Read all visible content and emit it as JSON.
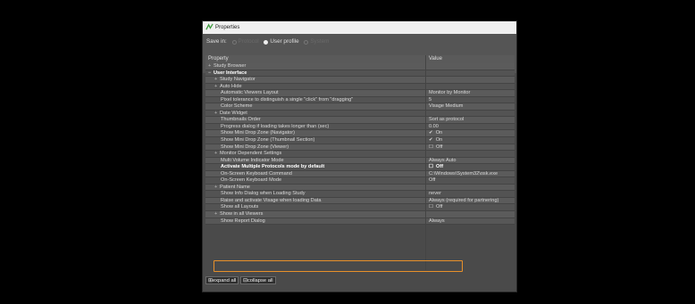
{
  "window": {
    "title": "Properties"
  },
  "save_in": {
    "label": "Save in:",
    "options": [
      {
        "label": "Protocol",
        "selected": false,
        "enabled": false
      },
      {
        "label": "User profile",
        "selected": true,
        "enabled": true
      },
      {
        "label": "System",
        "selected": false,
        "enabled": false
      }
    ]
  },
  "grid": {
    "col_property": "Property",
    "col_value": "Value",
    "rows": [
      {
        "prop": "Study Browser",
        "value": "",
        "indent": 0,
        "exp": "+"
      },
      {
        "prop": "User Interface",
        "value": "",
        "indent": 0,
        "exp": "−",
        "bold": true
      },
      {
        "prop": "Study Navigator",
        "value": "",
        "indent": 1,
        "exp": "+"
      },
      {
        "prop": "Auto Hide",
        "value": "",
        "indent": 1,
        "exp": "+"
      },
      {
        "prop": "Automatic Viewers Layout",
        "value": "Monitor by Monitor",
        "indent": 2
      },
      {
        "prop": "Pixel tolerance to distinguish a single \"click\" from \"dragging\"",
        "value": "5",
        "indent": 2
      },
      {
        "prop": "Color Scheme",
        "value": "Visage Medium",
        "indent": 2
      },
      {
        "prop": "Date Widget",
        "value": "",
        "indent": 1,
        "exp": "+"
      },
      {
        "prop": "Thumbnails Order",
        "value": "Sort as protocol",
        "indent": 2
      },
      {
        "prop": "Progress dialog if loading takes longer than (sec)",
        "value": "0.00",
        "indent": 2
      },
      {
        "prop": "Show Mini Drop Zone (Navigator)",
        "value": "On",
        "check": "✔",
        "indent": 2
      },
      {
        "prop": "Show Mini Drop Zone (Thumbnail Section)",
        "value": "On",
        "check": "✔",
        "indent": 2
      },
      {
        "prop": "Show Mini Drop Zone (Viewer)",
        "value": "Off",
        "check": "☐",
        "indent": 2
      },
      {
        "prop": "Monitor Dependent Settings",
        "value": "",
        "indent": 1,
        "exp": "+"
      },
      {
        "prop": "Multi Volume Indicator Mode",
        "value": "Always Auto",
        "indent": 2
      },
      {
        "prop": "Activate Multiple Protocols mode by default",
        "value": "Off",
        "check": "☐",
        "indent": 2,
        "bold": true
      },
      {
        "prop": "On-Screen Keyboard Command",
        "value": "C:\\Windows\\System32\\osk.exe",
        "indent": 2
      },
      {
        "prop": "On-Screen Keyboard Mode",
        "value": "Off",
        "indent": 2
      },
      {
        "prop": "Patient Name",
        "value": "",
        "indent": 1,
        "exp": "+"
      },
      {
        "prop": "Show Info Dialog when Loading Study",
        "value": "never",
        "indent": 2
      },
      {
        "prop": "Raise and activate Visage when loading Data",
        "value": "Always (required for partnering)",
        "indent": 2
      },
      {
        "prop": "Show all Layouts",
        "value": "Off",
        "check": "☐",
        "indent": 2
      },
      {
        "prop": "Show in all Viewers",
        "value": "",
        "indent": 1,
        "exp": "+"
      },
      {
        "prop": "Show Report Dialog",
        "value": "Always",
        "indent": 2,
        "highlight": true
      }
    ]
  },
  "buttons": {
    "expand_all": "expand all",
    "collapse_all": "collapse all"
  },
  "colors": {
    "highlight_border": "#e8902a",
    "dialog_bg": "#4a4a4a"
  }
}
